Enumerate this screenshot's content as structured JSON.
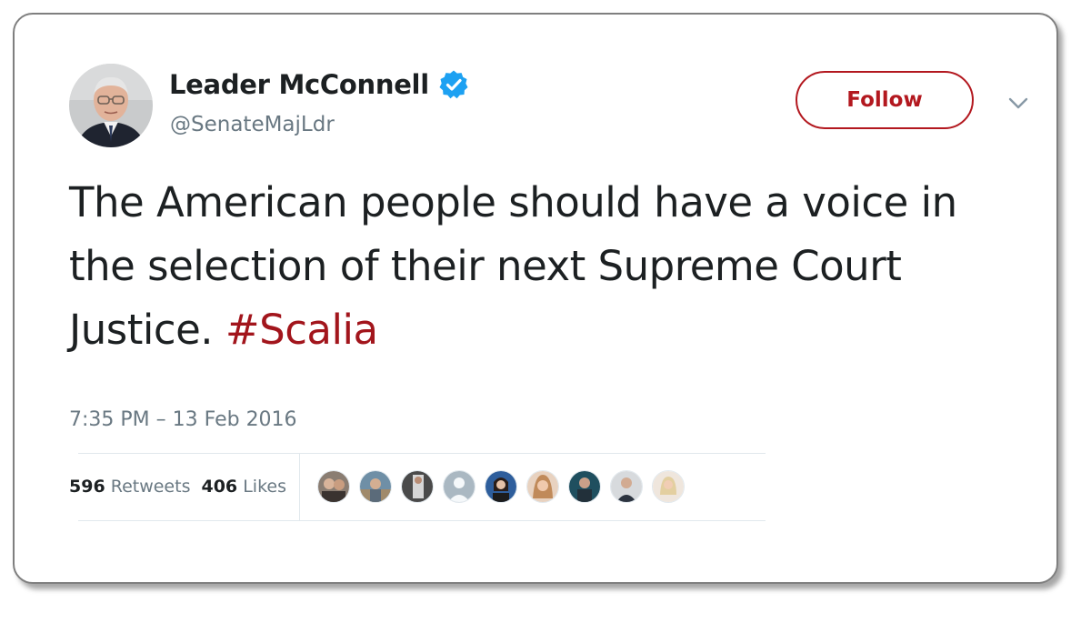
{
  "author": {
    "display_name": "Leader McConnell",
    "handle": "@SenateMajLdr",
    "verified": true,
    "avatar_icon": "profile-photo"
  },
  "header": {
    "follow_label": "Follow",
    "menu_icon": "chevron-down-icon"
  },
  "tweet": {
    "text": "The American people should have a voice in the selection of their next Supreme Court Justice. ",
    "hashtag": "#Scalia",
    "timestamp": "7:35 PM – 13 Feb 2016"
  },
  "stats": {
    "retweets_count": "596",
    "retweets_label": "Retweets",
    "likes_count": "406",
    "likes_label": "Likes"
  },
  "likers_count": 9,
  "colors": {
    "accent": "#b3181f",
    "hashtag": "#a2151c",
    "text": "#1c2022",
    "secondary": "#697882",
    "verified": "#1da1f2",
    "border": "#7f7f7f"
  }
}
